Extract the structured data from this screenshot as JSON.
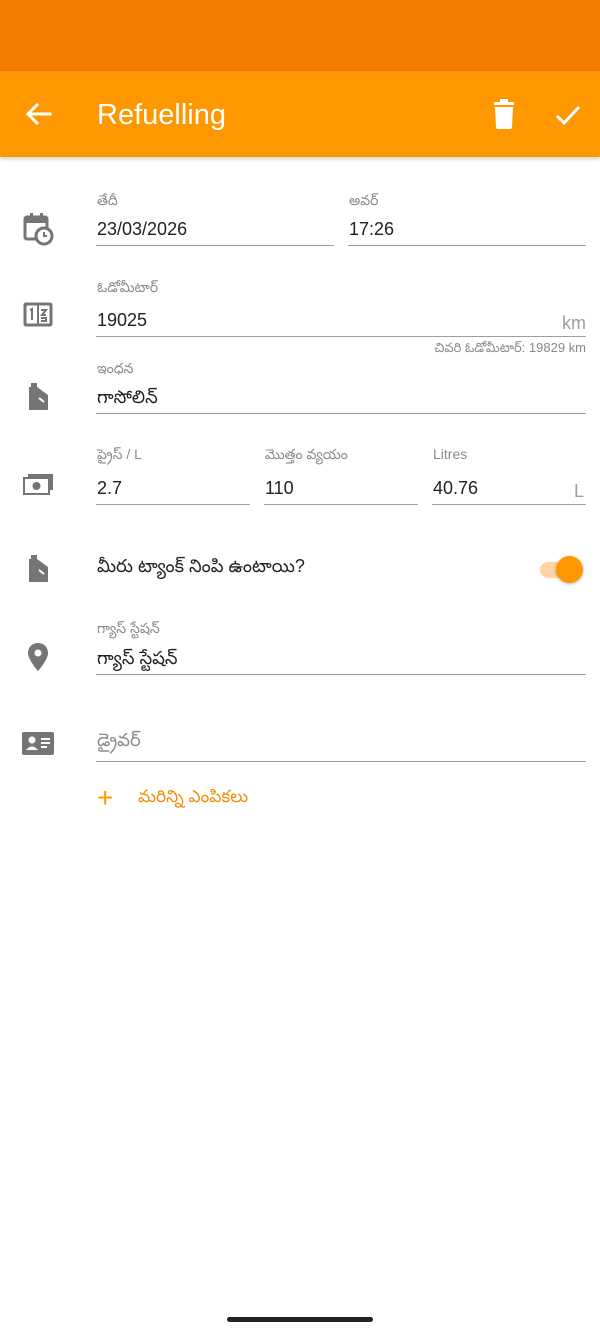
{
  "app_bar": {
    "title": "Refuelling"
  },
  "form": {
    "date": {
      "label": "తేదీ",
      "value": "23/03/2026"
    },
    "time": {
      "label": "అవర్",
      "value": "17:26"
    },
    "odometer": {
      "label": "ఓడోమీటార్",
      "value": "19025",
      "unit": "km",
      "helper": "చివరి ఓడోమీటార్: 19829 km"
    },
    "fuel": {
      "label": "ఇంధన",
      "value": "గాసోలిన్"
    },
    "price": {
      "label": "ప్రైస్ / L",
      "value": "2.7"
    },
    "total": {
      "label": "మొత్తం వ్యయం",
      "value": "110"
    },
    "litres": {
      "label": "Litres",
      "value": "40.76",
      "unit": "L"
    },
    "full_tank": {
      "label": "మీరు ట్యాంక్ నింపి ఉంటాయి?",
      "checked": true
    },
    "station": {
      "label": "గ్యాస్ స్టేషన్",
      "value": "గ్యాస్ స్టేషన్"
    },
    "driver": {
      "placeholder": "డ్రైవర్"
    },
    "more_options": "మరిన్ని ఎంపికలు"
  },
  "colors": {
    "primary": "#ff9800",
    "primary_dark": "#f57c00",
    "icon_gray": "#757575"
  }
}
